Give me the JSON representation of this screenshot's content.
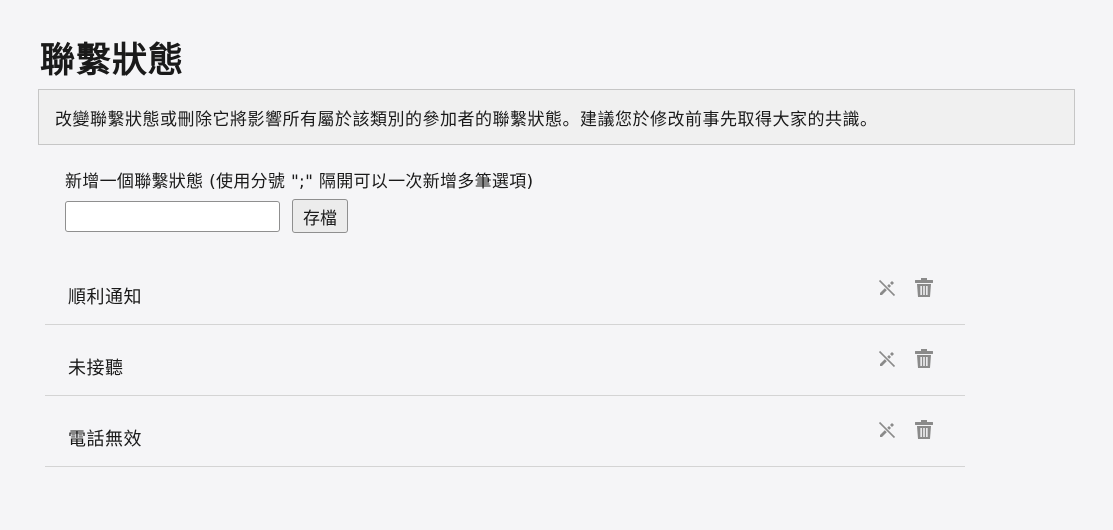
{
  "page": {
    "title": "聯繫狀態"
  },
  "notice": {
    "text": "改變聯繫狀態或刪除它將影響所有屬於該類別的參加者的聯繫狀態。建議您於修改前事先取得大家的共識。"
  },
  "add_form": {
    "label": "新增一個聯繫狀態 (使用分號 \";\" 隔開可以一次新增多筆選項)",
    "input_value": "",
    "save_label": "存檔"
  },
  "statuses": [
    {
      "name": "順利通知"
    },
    {
      "name": "未接聽"
    },
    {
      "name": "電話無效"
    }
  ],
  "icons": {
    "edit": "edit-off-icon",
    "delete": "trash-icon"
  },
  "colors": {
    "icon": "#8a8a8a",
    "background": "#f5f5f7",
    "notice_bg": "#f0f0f0",
    "divider": "#d4d4d4"
  }
}
